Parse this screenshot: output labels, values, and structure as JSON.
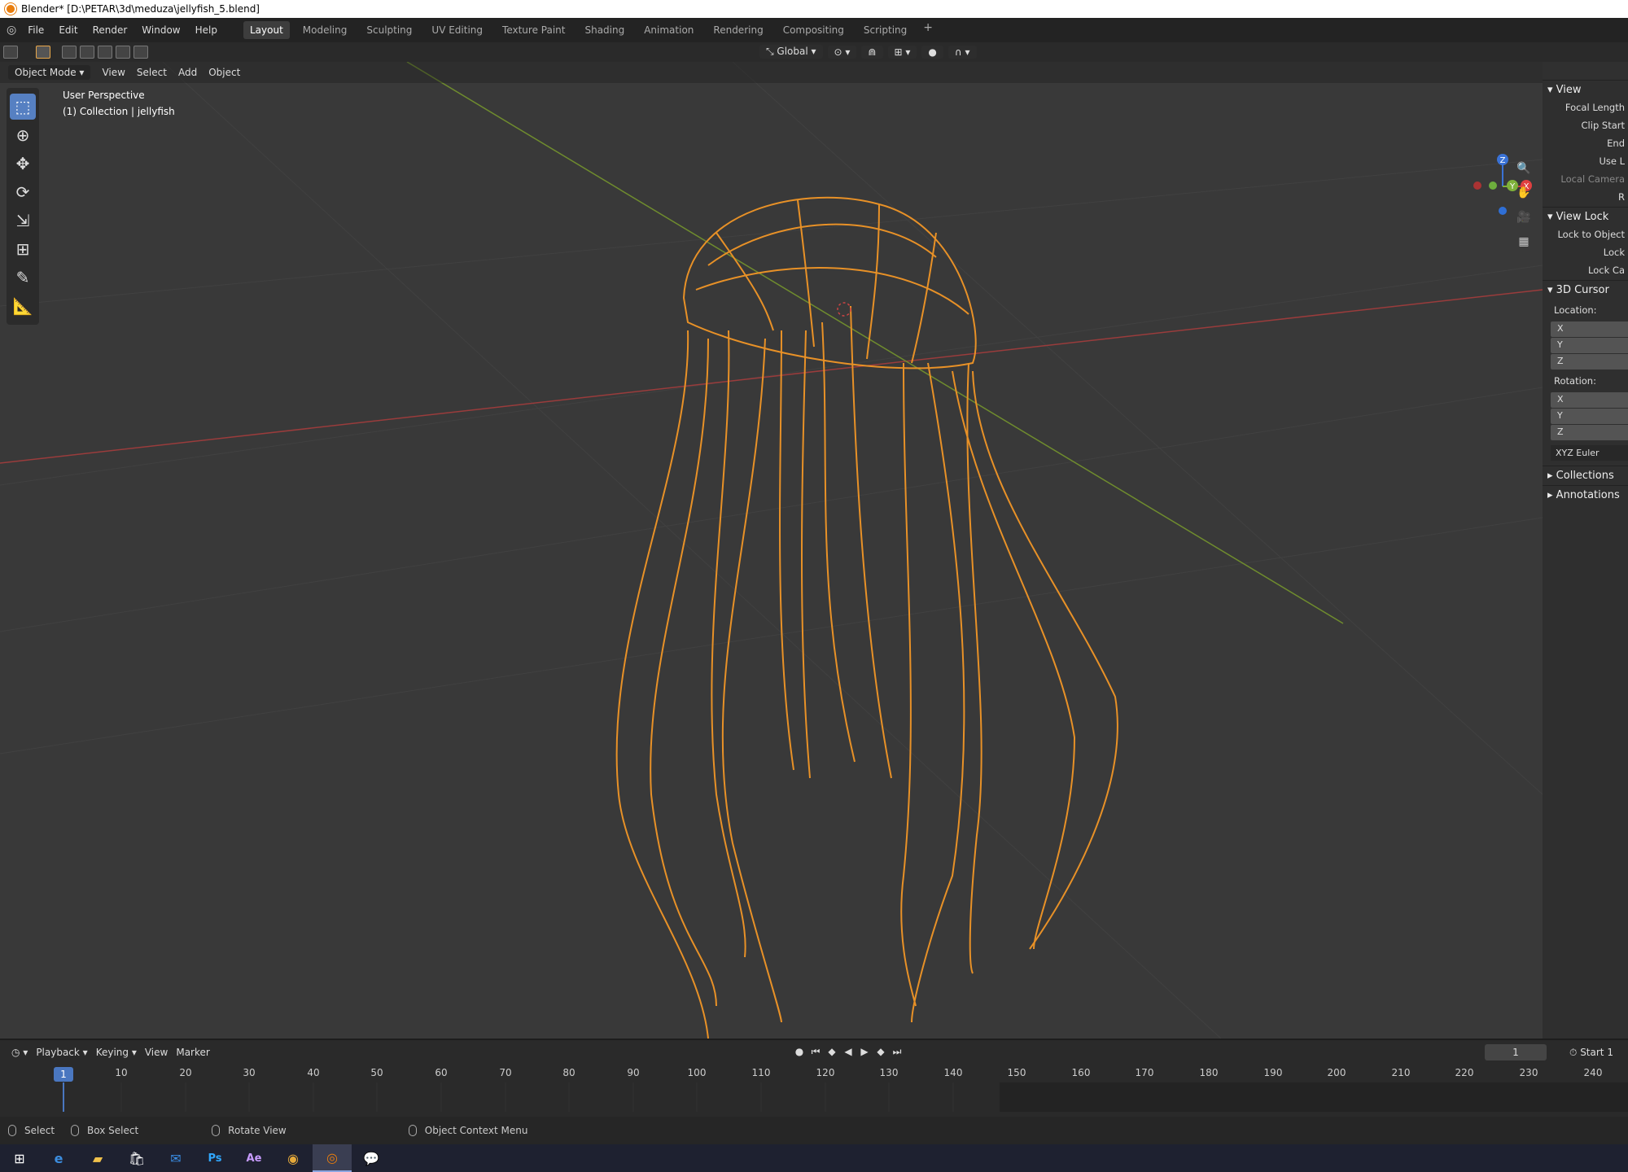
{
  "window": {
    "title": "Blender* [D:\\PETAR\\3d\\meduza\\jellyfish_5.blend]"
  },
  "menu": {
    "items": [
      "File",
      "Edit",
      "Render",
      "Window",
      "Help"
    ]
  },
  "workspaces": {
    "tabs": [
      "Layout",
      "Modeling",
      "Sculpting",
      "UV Editing",
      "Texture Paint",
      "Shading",
      "Animation",
      "Rendering",
      "Compositing",
      "Scripting"
    ],
    "active": "Layout",
    "add": "+"
  },
  "tool_header": {
    "orientation": "Global"
  },
  "viewport_header": {
    "mode": "Object Mode",
    "menus": [
      "View",
      "Select",
      "Add",
      "Object"
    ]
  },
  "viewport": {
    "perspective": "User Perspective",
    "collection": "(1) Collection | jellyfish",
    "wire_color": "#e89127",
    "bg_color": "#393939"
  },
  "gizmo": {
    "x": "X",
    "y": "Y",
    "z": "Z"
  },
  "sidebar": {
    "view_header": "View",
    "focal_length": "Focal Length",
    "clip_start": "Clip Start",
    "end": "End",
    "use_local": "Use L",
    "local_camera": "Local Camera",
    "render_region": "R",
    "view_lock_header": "View Lock",
    "lock_to_object": "Lock to Object",
    "lock": "Lock",
    "lock_camera": "Lock Ca",
    "cursor_header": "3D Cursor",
    "location_label": "Location:",
    "rotation_label": "Rotation:",
    "axes": [
      "X",
      "Y",
      "Z"
    ],
    "rotation_mode": "XYZ Euler",
    "collections": "Collections",
    "annotations": "Annotations"
  },
  "timeline": {
    "menus": [
      "Playback",
      "Keying",
      "View",
      "Marker"
    ],
    "current_frame": "1",
    "start_label": "Start",
    "start_value": "1",
    "ticks": [
      "10",
      "20",
      "30",
      "40",
      "50",
      "60",
      "70",
      "80",
      "90",
      "100",
      "110",
      "120",
      "130",
      "140",
      "150",
      "160",
      "170",
      "180",
      "190",
      "200",
      "210",
      "220",
      "230",
      "240"
    ],
    "cursor_frame": "1"
  },
  "statusbar": {
    "select": "Select",
    "box_select": "Box Select",
    "rotate_view": "Rotate View",
    "context_menu": "Object Context Menu"
  },
  "taskbar": {
    "apps": [
      "windows-start",
      "edge",
      "file-explorer",
      "store",
      "mail",
      "photoshop",
      "after-effects",
      "chrome",
      "blender",
      "chat"
    ],
    "ps_label": "Ps",
    "ae_label": "Ae"
  }
}
